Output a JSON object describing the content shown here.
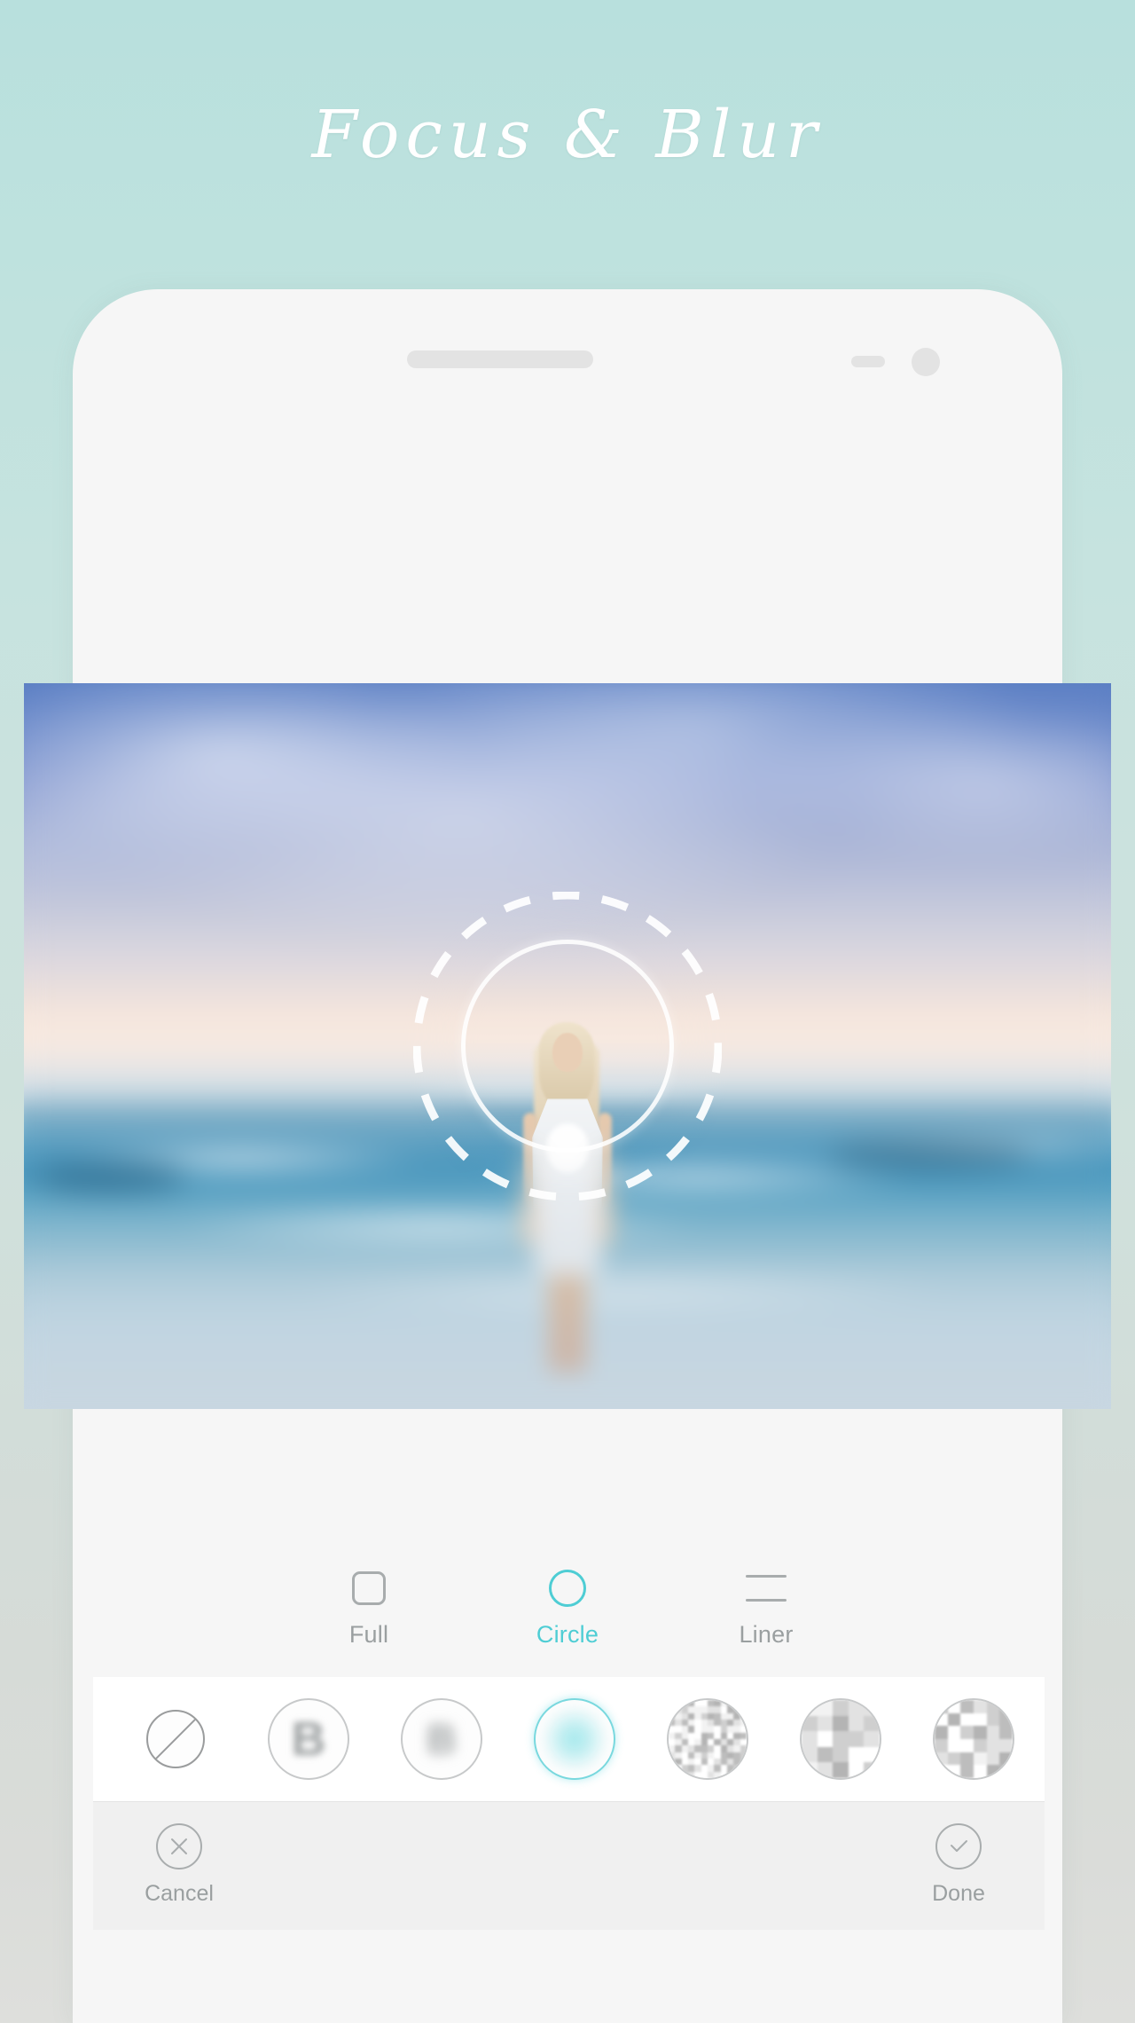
{
  "page": {
    "title": "Focus & Blur",
    "background_top_color": "#b8e0dd",
    "background_bottom_color": "#dedfdc",
    "accent_color": "#4ecdd4",
    "muted_color": "#9a9fa0"
  },
  "phone": {
    "speaker_icon": "speaker-grille-icon",
    "sensor_icon": "proximity-sensor-icon",
    "camera_icon": "front-camera-icon"
  },
  "photo": {
    "description": "Blurred beach photo of a woman in a white dress standing in ocean surf at dusk",
    "focus_ring_icon": "focus-circle-handle",
    "feather_ring_icon": "feather-circle-handle"
  },
  "tabs": [
    {
      "label": "Full",
      "icon": "rounded-square-icon",
      "active": false
    },
    {
      "label": "Circle",
      "icon": "circle-outline-icon",
      "active": true
    },
    {
      "label": "Liner",
      "icon": "two-lines-icon",
      "active": false
    }
  ],
  "filters": [
    {
      "name": "none",
      "icon": "no-blur-icon",
      "selected": false
    },
    {
      "name": "blur-1",
      "icon": "blur-soft-icon",
      "selected": false
    },
    {
      "name": "blur-2",
      "icon": "blur-strong-icon",
      "selected": false
    },
    {
      "name": "blur-3",
      "icon": "blur-glow-icon",
      "selected": true
    },
    {
      "name": "mosaic-1",
      "icon": "mosaic-fine-icon",
      "selected": false
    },
    {
      "name": "mosaic-2",
      "icon": "mosaic-medium-icon",
      "selected": false
    },
    {
      "name": "mosaic-3",
      "icon": "mosaic-coarse-icon",
      "selected": false
    }
  ],
  "bottom_bar": {
    "cancel": {
      "label": "Cancel",
      "icon": "close-x-icon"
    },
    "done": {
      "label": "Done",
      "icon": "check-icon"
    }
  }
}
